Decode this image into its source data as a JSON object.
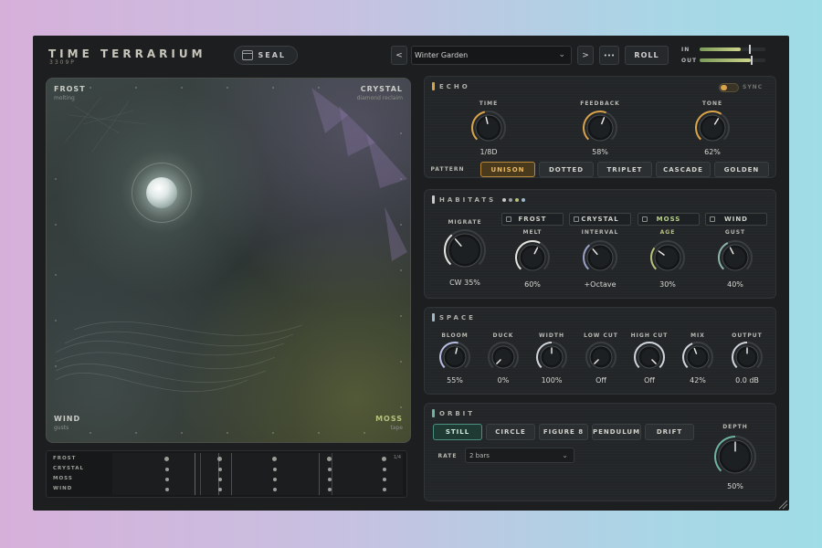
{
  "header": {
    "title": "TIME TERRARIUM",
    "subtitle": "3309P",
    "seal_label": "SEAL",
    "prev_label": "<",
    "preset_name": "Winter Garden",
    "next_label": ">",
    "more_label": "•••",
    "roll_label": "ROLL",
    "meter_in_label": "IN",
    "meter_out_label": "OUT",
    "meter_in_level": 0.62,
    "meter_out_level": 0.78
  },
  "pad": {
    "top_left": {
      "name": "FROST",
      "sub": "molting"
    },
    "top_right": {
      "name": "CRYSTAL",
      "sub": "diamond reclaim"
    },
    "bottom_left": {
      "name": "WIND",
      "sub": "gusts"
    },
    "bottom_right": {
      "name": "MOSS",
      "sub": "tape"
    }
  },
  "sequencer": {
    "rows": [
      "FROST",
      "CRYSTAL",
      "MOSS",
      "WIND"
    ],
    "tag": "1/4"
  },
  "echo": {
    "title": "ECHO",
    "sync_label": "SYNC",
    "accent": "#d9a34a",
    "knobs": [
      {
        "label": "TIME",
        "value": "1/8D",
        "level": 0.45
      },
      {
        "label": "FEEDBACK",
        "value": "58%",
        "level": 0.58
      },
      {
        "label": "TONE",
        "value": "62%",
        "level": 0.62
      }
    ],
    "pattern_label": "PATTERN",
    "patterns": [
      "UNISON",
      "DOTTED",
      "TRIPLET",
      "CASCADE",
      "GOLDEN"
    ],
    "active_pattern": "UNISON"
  },
  "habitats": {
    "title": "HABITATS",
    "migrate_label": "MIGRATE",
    "migrate_value": "CW 35%",
    "habitat_buttons": [
      "FROST",
      "CRYSTAL",
      "MOSS",
      "WIND"
    ],
    "knobs": [
      {
        "label": "MELT",
        "value": "60%",
        "level": 0.6
      },
      {
        "label": "INTERVAL",
        "value": "+Octave",
        "level": 0.35
      },
      {
        "label": "AGE",
        "value": "30%",
        "level": 0.3
      },
      {
        "label": "GUST",
        "value": "40%",
        "level": 0.4
      }
    ]
  },
  "space": {
    "title": "SPACE",
    "knobs": [
      {
        "label": "BLOOM",
        "value": "55%",
        "level": 0.55
      },
      {
        "label": "DUCK",
        "value": "0%",
        "level": 0.0
      },
      {
        "label": "WIDTH",
        "value": "100%",
        "level": 0.5
      },
      {
        "label": "LOW CUT",
        "value": "Off",
        "level": 0.0
      },
      {
        "label": "HIGH CUT",
        "value": "Off",
        "level": 1.0
      },
      {
        "label": "MIX",
        "value": "42%",
        "level": 0.42
      },
      {
        "label": "OUTPUT",
        "value": "0.0 dB",
        "level": 0.5
      }
    ]
  },
  "orbit": {
    "title": "ORBIT",
    "modes": [
      "STILL",
      "CIRCLE",
      "FIGURE 8",
      "PENDULUM",
      "DRIFT"
    ],
    "active_mode": "STILL",
    "rate_label": "RATE",
    "rate_value": "2 bars",
    "depth_label": "DEPTH",
    "depth_value": "50%",
    "depth_level": 0.5
  }
}
